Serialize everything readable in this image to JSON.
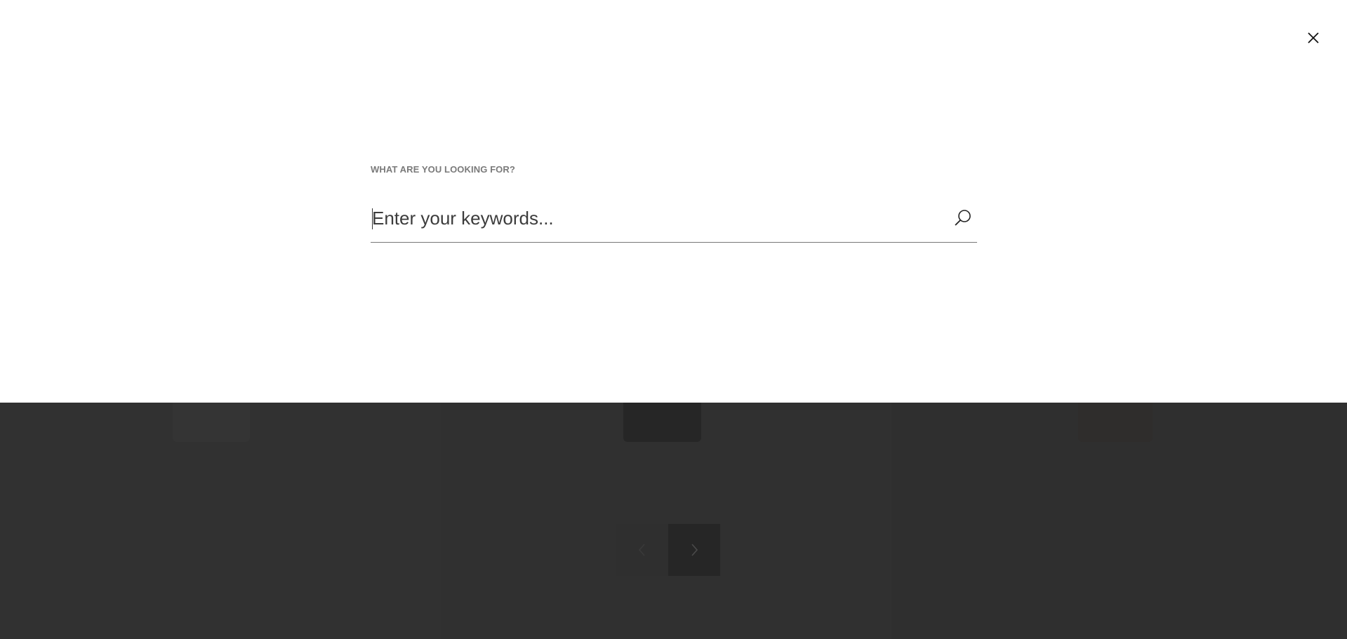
{
  "overlay": {
    "label": "WHAT ARE YOU LOOKING FOR?",
    "input_placeholder": "Enter your keywords...",
    "input_value": "",
    "close_icon": "close-icon",
    "search_icon": "search-icon"
  },
  "pager": {
    "prev_icon": "chevron-left-icon",
    "next_icon": "chevron-right-icon"
  },
  "colors": {
    "overlay_background": "#ffffff",
    "backdrop": "#2e2e2e",
    "label_text": "#7a7a7a"
  }
}
